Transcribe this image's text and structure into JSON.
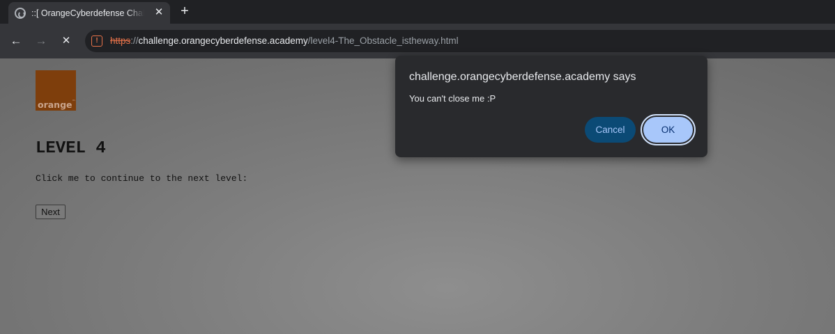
{
  "browser": {
    "tab": {
      "title": "::[ OrangeCyberdefense Challenge",
      "close_glyph": "✕"
    },
    "new_tab_glyph": "+",
    "nav": {
      "back_glyph": "←",
      "forward_glyph": "→",
      "stop_glyph": "✕"
    },
    "address": {
      "scheme": "https",
      "rest": "://",
      "host": "challenge.orangecyberdefense.academy",
      "path": "/level4-The_Obstacle_istheway.html",
      "security_icon": "warning-icon"
    }
  },
  "page": {
    "logo_text": "orange",
    "logo_tm": "™",
    "title": "LEVEL 4",
    "instruction": "Click me to continue to the next level:",
    "next_label": "Next"
  },
  "dialog": {
    "title": "challenge.orangecyberdefense.academy says",
    "message": "You can't close me :P",
    "cancel_label": "Cancel",
    "ok_label": "OK"
  },
  "colors": {
    "brand_orange": "#7e3e0c",
    "accent_blue": "#a8c7fa",
    "cancel_blue": "#0b4a75",
    "warning": "#e8734a"
  }
}
